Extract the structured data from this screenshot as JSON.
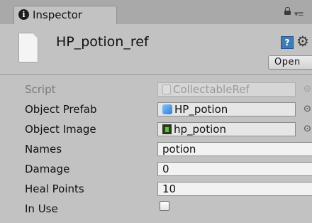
{
  "tab": {
    "icon": "info-icon",
    "label": "Inspector"
  },
  "header": {
    "asset_name": "HP_potion_ref",
    "open_label": "Open"
  },
  "rows": [
    {
      "label": "Script",
      "value": "CollectableRef",
      "icon": "script-icon",
      "disabled": true
    },
    {
      "label": "Object Prefab",
      "value": "HP_potion",
      "icon": "prefab-cube-icon"
    },
    {
      "label": "Object Image",
      "value": "hp_potion",
      "icon": "sprite-icon"
    },
    {
      "label": "Names",
      "value": "potion"
    },
    {
      "label": "Damage",
      "value": "0"
    },
    {
      "label": "Heal Points",
      "value": "10"
    },
    {
      "label": "In Use",
      "checked": false
    }
  ]
}
